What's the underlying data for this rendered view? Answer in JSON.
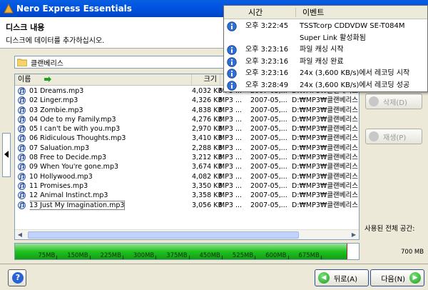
{
  "window": {
    "title": "Nero Express Essentials"
  },
  "header": {
    "title": "디스크 내용",
    "subtitle": "디스크에 데이터를 추가하십시오."
  },
  "folder": {
    "name": "클랜베리스"
  },
  "file_list": {
    "columns": [
      "이름",
      "크기",
      "종"
    ],
    "rows": [
      {
        "name": "01 Dreams.mp3",
        "size": "4,032 KB",
        "type": "MP3 ...",
        "date": "2007-05,...",
        "path": "D:₩MP3₩클랜베리스..."
      },
      {
        "name": "02 Linger.mp3",
        "size": "4,326 KB",
        "type": "MP3 ...",
        "date": "2007-05,...",
        "path": "D:₩MP3₩클랜베리스..."
      },
      {
        "name": "03 Zombie.mp3",
        "size": "4,838 KB",
        "type": "MP3 ...",
        "date": "2007-05,...",
        "path": "D:₩MP3₩클랜베리스..."
      },
      {
        "name": "04 Ode to my Family.mp3",
        "size": "4,276 KB",
        "type": "MP3 ...",
        "date": "2007-05,...",
        "path": "D:₩MP3₩클랜베리스..."
      },
      {
        "name": "05 I can't be with you.mp3",
        "size": "2,970 KB",
        "type": "MP3 ...",
        "date": "2007-05,...",
        "path": "D:₩MP3₩클랜베리스..."
      },
      {
        "name": "06 Ridiculous Thoughts.mp3",
        "size": "3,410 KB",
        "type": "MP3 ...",
        "date": "2007-05,...",
        "path": "D:₩MP3₩클랜베리스..."
      },
      {
        "name": "07 Saluation.mp3",
        "size": "2,288 KB",
        "type": "MP3 ...",
        "date": "2007-05,...",
        "path": "D:₩MP3₩클랜베리스..."
      },
      {
        "name": "08 Free to Decide.mp3",
        "size": "3,212 KB",
        "type": "MP3 ...",
        "date": "2007-05,...",
        "path": "D:₩MP3₩클랜베리스..."
      },
      {
        "name": "09 When You're gone.mp3",
        "size": "3,674 KB",
        "type": "MP3 ...",
        "date": "2007-05,...",
        "path": "D:₩MP3₩클랜베리스..."
      },
      {
        "name": "10 Hollywood.mp3",
        "size": "4,082 KB",
        "type": "MP3 ...",
        "date": "2007-05,...",
        "path": "D:₩MP3₩클랜베리스..."
      },
      {
        "name": "11 Promises.mp3",
        "size": "3,350 KB",
        "type": "MP3 ...",
        "date": "2007-05,...",
        "path": "D:₩MP3₩클랜베리스..."
      },
      {
        "name": "12 Animal Instinct.mp3",
        "size": "3,358 KB",
        "type": "MP3 ...",
        "date": "2007-05,...",
        "path": "D:₩MP3₩클랜베리스..."
      },
      {
        "name": "13 Just My Imagination.mp3",
        "size": "3,056 KB",
        "type": "MP3 ...",
        "date": "2007-05,...",
        "path": "D:₩MP3₩클랜베리스..."
      }
    ]
  },
  "buttons": {
    "delete": "삭제(D)",
    "play": "재생(P)",
    "back": "뒤로(A)",
    "next": "다음(N)",
    "help": "?"
  },
  "capacity": {
    "total_label": "사용된 전체 공간:",
    "max_label": "700 MB",
    "used_fraction": 0.965,
    "ticks": [
      "75MB",
      "150MB",
      "225MB",
      "300MB",
      "375MB",
      "450MB",
      "525MB",
      "600MB",
      "675MB"
    ],
    "fill_color": "#1fc21f"
  },
  "event_log": {
    "columns": [
      "시간",
      "이벤트"
    ],
    "rows": [
      {
        "time": "오후 3:22:45",
        "event": "TSSTcorp CDDVDW SE-T084M",
        "icon": true
      },
      {
        "time": "",
        "event": "Super Link 활성화됨",
        "icon": false
      },
      {
        "time": "오후 3:23:16",
        "event": "파일 캐싱 시작",
        "icon": true
      },
      {
        "time": "오후 3:23:16",
        "event": "파일 캐싱 완료",
        "icon": true
      },
      {
        "time": "오후 3:23:16",
        "event": "24x (3,600 KB/s)에서 레코딩 시작",
        "icon": true
      },
      {
        "time": "오후 3:28:49",
        "event": "24x (3,600 KB/s)에서 레코딩 성공",
        "icon": true
      }
    ]
  },
  "colors": {
    "titlebar": "#0054e3",
    "accent_green": "#1c9a1c"
  }
}
